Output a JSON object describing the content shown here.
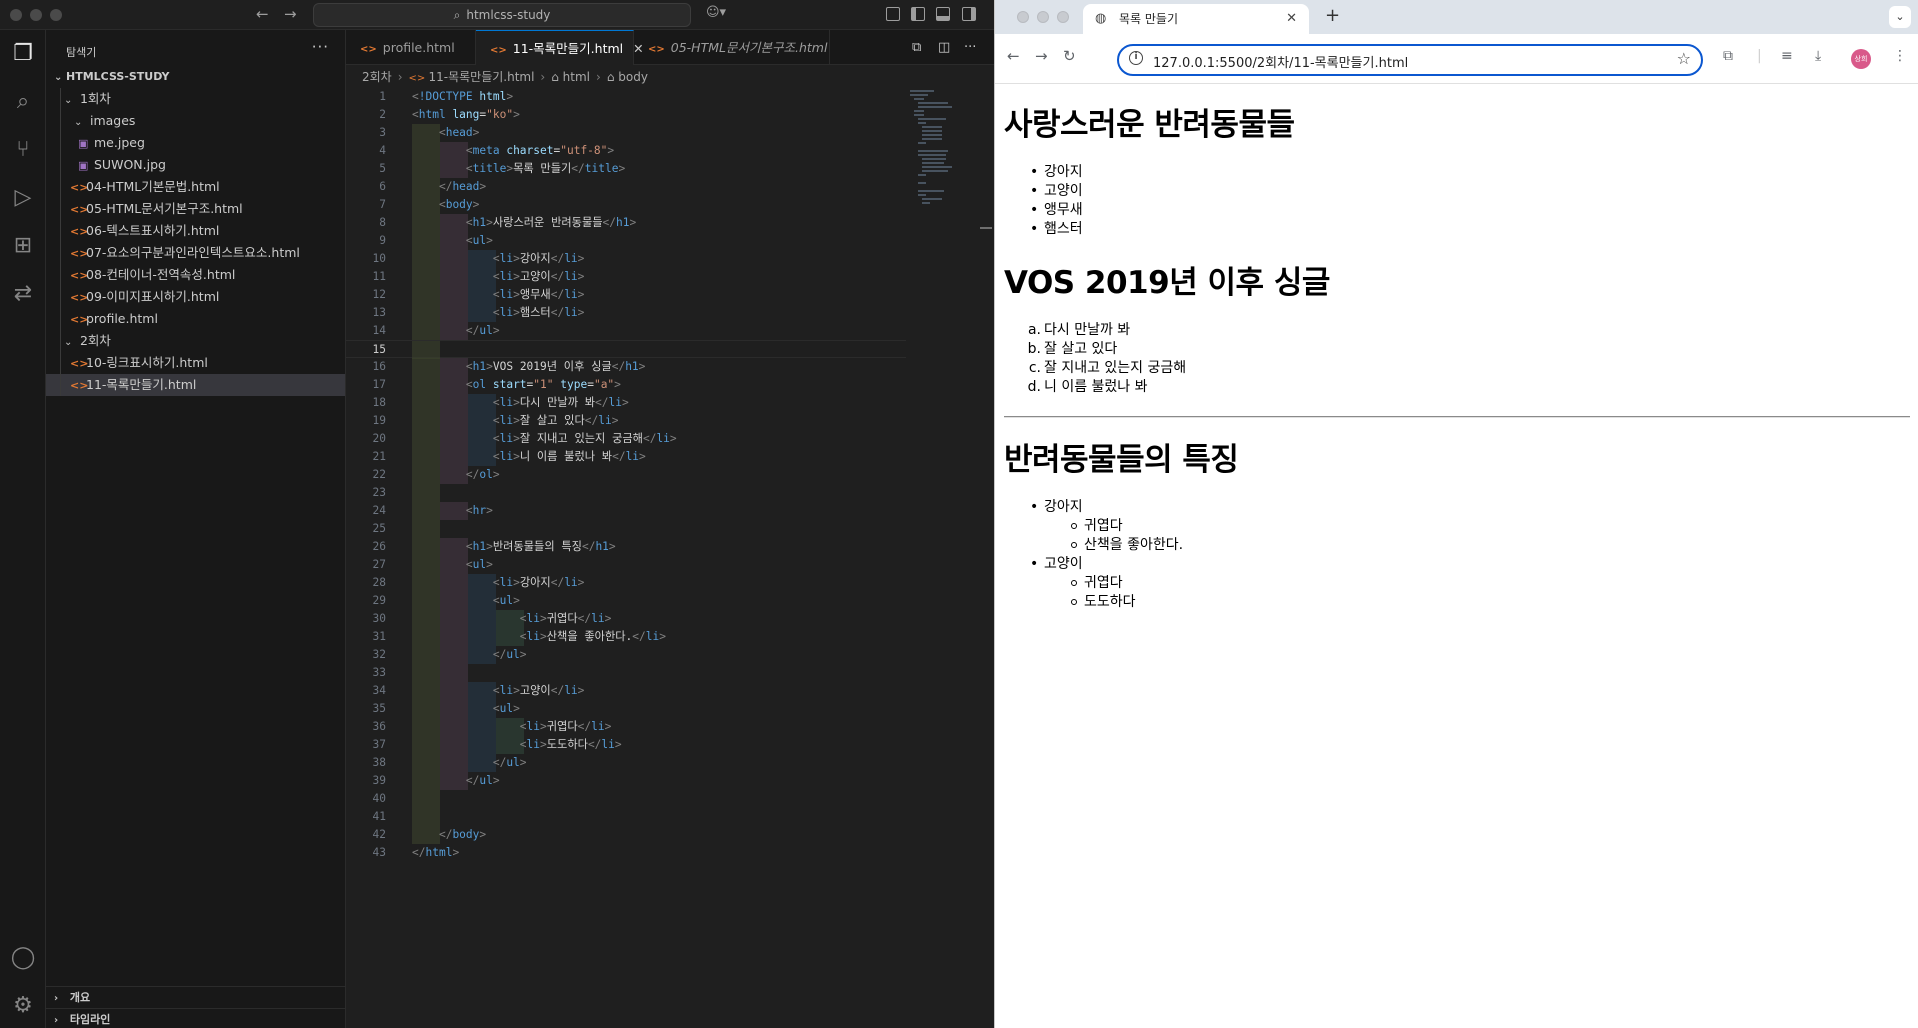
{
  "vscode": {
    "search_text": "htmlcss-study",
    "explorer_title": "탐색기",
    "more": "···",
    "tree": {
      "root": "HTMLCSS-STUDY",
      "folder1": "1회차",
      "images": "images",
      "me": "me.jpeg",
      "suwon": "SUWON.jpg",
      "f04": "04-HTML기본문법.html",
      "f05": "05-HTML문서기본구조.html",
      "f06": "06-텍스트표시하기.html",
      "f07": "07-요소의구분과인라인텍스트요소.html",
      "f08": "08-컨테이너-전역속성.html",
      "f09": "09-이미지표시하기.html",
      "profile": "profile.html",
      "folder2": "2회차",
      "f10": "10-링크표시하기.html",
      "f11": "11-목록만들기.html"
    },
    "outline": "개요",
    "timeline": "타임라인",
    "tabs": {
      "t1": "profile.html",
      "t2": "11-목록만들기.html",
      "t3": "05-HTML문서기본구조.html"
    },
    "breadcrumb": {
      "b1": "2회차",
      "b2": "11-목록만들기.html",
      "b3": "html",
      "b4": "body"
    },
    "code": {
      "l1_doctype": "!DOCTYPE",
      "l1_html": " html",
      "l2_html": "html",
      "l2_lang": " lang",
      "l2_ko": "\"ko\"",
      "head": "head",
      "meta": "meta",
      "charset": " charset",
      "utf8": "\"utf-8\"",
      "title": "title",
      "title_txt": "목록 만들기",
      "body": "body",
      "h1": "h1",
      "h1_a": "사랑스러운 반려동물들",
      "ul": "ul",
      "li": "li",
      "li_dog": "강아지",
      "li_cat": "고양이",
      "li_parrot": "앵무새",
      "li_hamster": "햄스터",
      "h1_b": "VOS 2019년 이후 싱글",
      "ol": "ol",
      "start": " start",
      "start_v": "\"1\"",
      "type": " type",
      "type_v": "\"a\"",
      "s1": "다시 만날까 봐",
      "s2": "잘 살고 있다",
      "s3": "잘 지내고 있는지 궁금해",
      "s4": "니 이름 불렀나 봐",
      "hr": "hr",
      "h1_c": "반려동물들의 특징",
      "cute": "귀엽다",
      "walk": "산책을 좋아한다.",
      "proud": "도도하다"
    }
  },
  "chrome": {
    "tab_title": "목록 만들기",
    "url": "127.0.0.1:5500/2회차/11-목록만들기.html",
    "profile_label": "상희"
  },
  "page": {
    "h1_pets": "사랑스러운 반려동물들",
    "pets": [
      "강아지",
      "고양이",
      "앵무새",
      "햄스터"
    ],
    "h1_vos": "VOS 2019년 이후 싱글",
    "songs": [
      "다시 만날까 봐",
      "잘 살고 있다",
      "잘 지내고 있는지 궁금해",
      "니 이름 불렀나 봐"
    ],
    "song_markers": [
      "a.",
      "b.",
      "c.",
      "d."
    ],
    "h1_traits": "반려동물들의 특징",
    "dog": "강아지",
    "dog_traits": [
      "귀엽다",
      "산책을 좋아한다."
    ],
    "cat": "고양이",
    "cat_traits": [
      "귀엽다",
      "도도하다"
    ]
  }
}
